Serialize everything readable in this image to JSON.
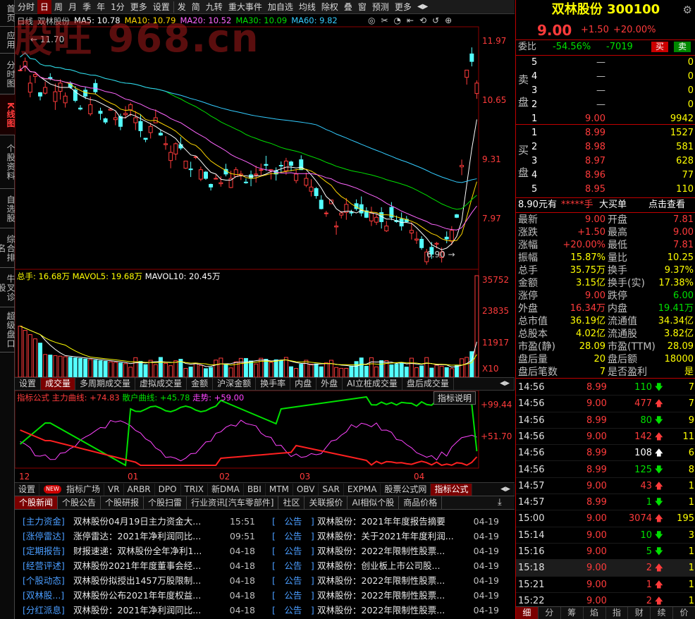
{
  "sidebar": [
    "首页",
    "应用",
    "分时图",
    "K线图",
    "个股资料",
    "自选股",
    "综合排名",
    "牛叉诊股",
    "超级盘口"
  ],
  "sidebar_active": 3,
  "topbar": {
    "items": [
      "分时",
      "日",
      "周",
      "月",
      "季",
      "年",
      "1分",
      "更多",
      "设置"
    ],
    "active": 1,
    "items2": [
      "发",
      "简",
      "九转",
      "重大事件",
      "加自选",
      "均线",
      "除权",
      "叠",
      "窗",
      "预测",
      "更多"
    ]
  },
  "watermark": "股旺 968.cn",
  "ma_line": {
    "period": "日线",
    "name": "双林股份",
    "ma5": "MA5: 10.78",
    "ma10": "MA10: 10.79",
    "ma20": "MA20: 10.52",
    "ma30": "MA30: 10.09",
    "ma60": "MA60: 9.82"
  },
  "price_axis": [
    "11.97",
    "10.65",
    "9.31",
    "7.97"
  ],
  "high_label": "11.70",
  "low_label": "6.90",
  "vol_line": {
    "total": "总手: 16.68万",
    "mavol5": "MAVOL5: 19.68万",
    "mavol10": "MAVOL10: 20.45万"
  },
  "vol_axis": [
    "35752",
    "23835",
    "11917",
    "X10"
  ],
  "tabs1": [
    "设置",
    "成交量",
    "多周期成交量",
    "虚拟成交量",
    "金额",
    "沪深金额",
    "换手率",
    "内盘",
    "外盘",
    "AI立桩成交量",
    "盘后成交量"
  ],
  "tabs1_active": 1,
  "ind_line": {
    "name": "指标公式",
    "main": "主力曲线: +74.83",
    "retail": "散户曲线: +45.78",
    "trend": "走势: +59.00"
  },
  "ind_button": "指标说明",
  "ind_axis": [
    "+99.44",
    "+51.70"
  ],
  "months": [
    "12",
    "01",
    "02",
    "03",
    "04"
  ],
  "tabs2": [
    "设置",
    "指标广场",
    "VR",
    "ARBR",
    "DPO",
    "TRIX",
    "新DMA",
    "BBI",
    "MTM",
    "OBV",
    "SAR",
    "EXPMA",
    "股票公式网",
    "指标公式"
  ],
  "tabs2_new": "NEW",
  "tabs3": [
    "个股新闻",
    "个股公告",
    "个股研报",
    "个股扫雷",
    "行业资讯[汽车零部件]",
    "社区",
    "关联报价",
    "AI相似个股",
    "商品价格"
  ],
  "news_left": [
    {
      "cat": "[主力资金]",
      "title": "双林股份04月19日主力资金大...",
      "date": "15:51"
    },
    {
      "cat": "[涨停雷达]",
      "title": "涨停雷达：2021年净利润同比...",
      "date": "09:51"
    },
    {
      "cat": "[定期报告]",
      "title": "财报速递：双林股份全年净利1...",
      "date": "04-18"
    },
    {
      "cat": "[经营评述]",
      "title": "双林股份2021年年度董事会经...",
      "date": "04-18"
    },
    {
      "cat": "[个股动态]",
      "title": "双林股份拟授出1457万股限制...",
      "date": "04-18"
    },
    {
      "cat": "[双林股...]",
      "title": "双林股份公布2021年年度权益...",
      "date": "04-18"
    },
    {
      "cat": "[分红派息]",
      "title": "双林股份：2021年净利润同比...",
      "date": "04-18"
    }
  ],
  "news_right": [
    {
      "cat": "[　公告　]",
      "title": "双林股份：2021年年度报告摘要",
      "date": "04-19"
    },
    {
      "cat": "[　公告　]",
      "title": "双林股份：关于2021年年度利润...",
      "date": "04-19"
    },
    {
      "cat": "[　公告　]",
      "title": "双林股份：2022年限制性股票...",
      "date": "04-19"
    },
    {
      "cat": "[　公告　]",
      "title": "双林股份：创业板上市公司股...",
      "date": "04-19"
    },
    {
      "cat": "[　公告　]",
      "title": "双林股份：2022年限制性股票...",
      "date": "04-19"
    },
    {
      "cat": "[　公告　]",
      "title": "双林股份：2022年限制性股票...",
      "date": "04-19"
    },
    {
      "cat": "[　公告　]",
      "title": "双林股份：2022年限制性股票...",
      "date": "04-19"
    }
  ],
  "quote": {
    "name": "双林股份",
    "code": "300100",
    "price": "9.00",
    "change": "+1.50",
    "pct": "+20.00%"
  },
  "weibi": {
    "label": "委比",
    "ratio": "-54.56%",
    "diff": "-7019",
    "buy": "买",
    "sell": "卖"
  },
  "sell": [
    {
      "n": "5",
      "p": "—",
      "v": "0"
    },
    {
      "n": "4",
      "p": "—",
      "v": "0"
    },
    {
      "n": "3",
      "p": "—",
      "v": "0"
    },
    {
      "n": "2",
      "p": "—",
      "v": "0"
    },
    {
      "n": "1",
      "p": "9.00",
      "v": "9942"
    }
  ],
  "buy": [
    {
      "n": "1",
      "p": "8.99",
      "v": "1527"
    },
    {
      "n": "2",
      "p": "8.98",
      "v": "581"
    },
    {
      "n": "3",
      "p": "8.97",
      "v": "628"
    },
    {
      "n": "4",
      "p": "8.96",
      "v": "77"
    },
    {
      "n": "5",
      "p": "8.95",
      "v": "110"
    }
  ],
  "sell_label": [
    "卖",
    "盘"
  ],
  "buy_label": [
    "买",
    "盘"
  ],
  "big": {
    "price": "8.90元有",
    "stars": "*****手",
    "bigbuy": "大买单",
    "link": "点击查看"
  },
  "stats": [
    [
      "最新",
      "9.00",
      "开盘",
      "7.81"
    ],
    [
      "涨跌",
      "+1.50",
      "最高",
      "9.00"
    ],
    [
      "涨幅",
      "+20.00%",
      "最低",
      "7.81"
    ],
    [
      "振幅",
      "15.87%",
      "量比",
      "10.25"
    ],
    [
      "总手",
      "35.75万",
      "换手",
      "9.37%"
    ],
    [
      "金额",
      "3.15亿",
      "换手(实)",
      "17.38%"
    ],
    [
      "涨停",
      "9.00",
      "跌停",
      "6.00"
    ],
    [
      "外盘",
      "16.34万",
      "内盘",
      "19.41万"
    ],
    [
      "总市值",
      "36.19亿",
      "流通值",
      "34.34亿"
    ],
    [
      "总股本",
      "4.02亿",
      "流通股",
      "3.82亿"
    ],
    [
      "市盈(静)",
      "28.09",
      "市盈(TTM)",
      "28.09"
    ],
    [
      "盘后量",
      "20",
      "盘后额",
      "18000"
    ],
    [
      "盘后笔数",
      "7",
      "是否盈利",
      "是"
    ]
  ],
  "ticks": [
    {
      "t": "14:56",
      "p": "8.99",
      "v": "110",
      "d": "down",
      "n": "7"
    },
    {
      "t": "14:56",
      "p": "9.00",
      "v": "477",
      "d": "up",
      "n": "7"
    },
    {
      "t": "14:56",
      "p": "8.99",
      "v": "80",
      "d": "down",
      "n": "9"
    },
    {
      "t": "14:56",
      "p": "9.00",
      "v": "142",
      "d": "up",
      "n": "11"
    },
    {
      "t": "14:56",
      "p": "8.99",
      "v": "108",
      "d": "upw",
      "n": "6"
    },
    {
      "t": "14:56",
      "p": "8.99",
      "v": "125",
      "d": "down",
      "n": "8"
    },
    {
      "t": "14:57",
      "p": "9.00",
      "v": "43",
      "d": "up",
      "n": "1"
    },
    {
      "t": "14:57",
      "p": "8.99",
      "v": "1",
      "d": "down",
      "n": "1"
    },
    {
      "t": "15:00",
      "p": "9.00",
      "v": "3074",
      "d": "up",
      "n": "195"
    },
    {
      "t": "15:14",
      "p": "9.00",
      "v": "10",
      "d": "down",
      "n": "3"
    },
    {
      "t": "15:16",
      "p": "9.00",
      "v": "5",
      "d": "down",
      "n": "1"
    },
    {
      "t": "15:18",
      "p": "9.00",
      "v": "2",
      "d": "up",
      "n": "1"
    },
    {
      "t": "15:21",
      "p": "9.00",
      "v": "1",
      "d": "up",
      "n": "1"
    },
    {
      "t": "15:22",
      "p": "9.00",
      "v": "2",
      "d": "up",
      "n": "1"
    }
  ],
  "bottom_tabs": [
    "细",
    "分",
    "筹",
    "焰",
    "指",
    "财",
    "续",
    "价"
  ]
}
